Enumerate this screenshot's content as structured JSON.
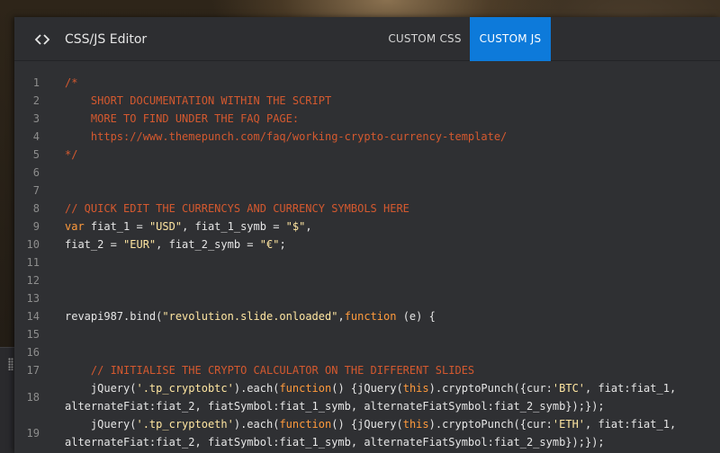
{
  "editor": {
    "title": "CSS/JS Editor",
    "icon": "code-icon",
    "tabs": [
      {
        "label": "CUSTOM CSS",
        "active": false
      },
      {
        "label": "CUSTOM JS",
        "active": true
      }
    ],
    "accent_color": "#0d7ada"
  },
  "code": {
    "line_numbers": [
      "1",
      "2",
      "3",
      "4",
      "5",
      "6",
      "7",
      "8",
      "9",
      "10",
      "11",
      "12",
      "13",
      "14",
      "15",
      "16",
      "17",
      "18",
      "19"
    ],
    "lines": {
      "l1": "/*",
      "l2": "    SHORT DOCUMENTATION WITHIN THE SCRIPT",
      "l3": "    MORE TO FIND UNDER THE FAQ PAGE:",
      "l4": "    https://www.themepunch.com/faq/working-crypto-currency-template/",
      "l5": "*/",
      "l8": "// QUICK EDIT THE CURRENCYS AND CURRENCY SYMBOLS HERE",
      "l9": {
        "kw": "var",
        "p1": " fiat_1 = ",
        "s1": "\"USD\"",
        "p2": ", fiat_1_symb = ",
        "s2": "\"$\"",
        "p3": ","
      },
      "l10": {
        "p1": "fiat_2 = ",
        "s1": "\"EUR\"",
        "p2": ", fiat_2_symb = ",
        "s2": "\"€\"",
        "p3": ";"
      },
      "l14": {
        "p1": "revapi987.bind(",
        "s1": "\"revolution.slide.onloaded\"",
        "p2": ",",
        "kw": "function",
        "p3": " (e) {"
      },
      "l17": "    // INITIALISE THE CRYPTO CALCULATOR ON THE DIFFERENT SLIDES",
      "l18a": {
        "p1": "    jQuery(",
        "s1": "'.tp_cryptobtc'",
        "p2": ").each(",
        "kw1": "function",
        "p3": "() {jQuery(",
        "kw2": "this",
        "p4": ").cryptoPunch({cur:",
        "s2": "'BTC'",
        "p5": ", fiat:fiat_1,"
      },
      "l18b": "alternateFiat:fiat_2, fiatSymbol:fiat_1_symb, alternateFiatSymbol:fiat_2_symb});});",
      "l19a": {
        "p1": "    jQuery(",
        "s1": "'.tp_cryptoeth'",
        "p2": ").each(",
        "kw1": "function",
        "p3": "() {jQuery(",
        "kw2": "this",
        "p4": ").cryptoPunch({cur:",
        "s2": "'ETH'",
        "p5": ", fiat:fiat_1,"
      },
      "l19b": "alternateFiat:fiat_2, fiatSymbol:fiat_1_symb, alternateFiatSymbol:fiat_2_symb});});"
    }
  }
}
